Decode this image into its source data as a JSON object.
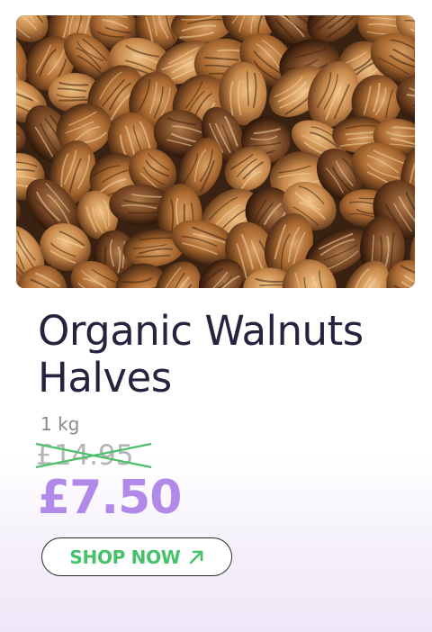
{
  "product": {
    "image_subject": "walnut halves",
    "title": "Organic Walnuts Halves",
    "weight": "1 kg",
    "old_price": "£14.95",
    "new_price": "£7.50",
    "cta_label": "SHOP NOW",
    "cta_icon": "arrow-up-right-icon"
  },
  "colors": {
    "title": "#24243f",
    "price": "#b18ae9",
    "cta_text": "#45c26a",
    "strike_line": "#4bbf6a",
    "old_price": "#b5b5b5"
  }
}
